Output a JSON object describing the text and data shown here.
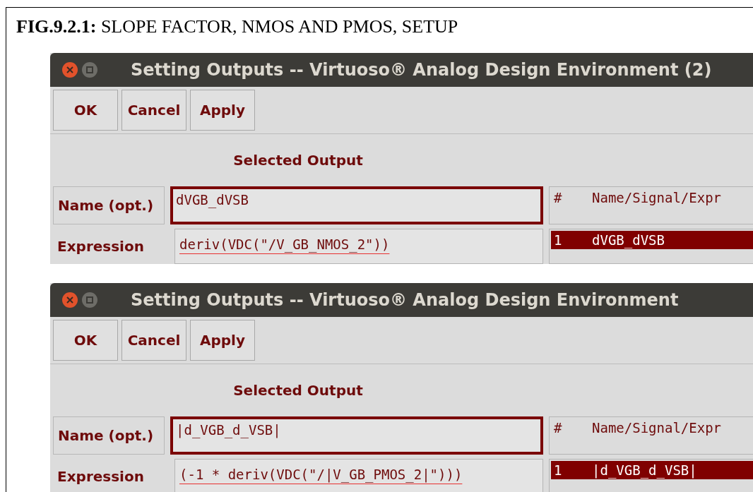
{
  "caption": {
    "label": "FIG.9.2.1:",
    "text": "SLOPE FACTOR, NMOS AND PMOS, SETUP"
  },
  "windows": [
    {
      "title": "Setting Outputs -- Virtuoso® Analog Design Environment (2)",
      "buttons": [
        "OK",
        "Cancel",
        "Apply"
      ],
      "section_title": "Selected Output",
      "name_label": "Name (opt.)",
      "name_value": "dVGB_dVSB",
      "name_focused": true,
      "expression_label": "Expression",
      "expression_value": "deriv(VDC(\"/V_GB_NMOS_2\"))",
      "expression_focused": false,
      "list": {
        "columns": [
          "#",
          "Name/Signal/Expr"
        ],
        "rows": [
          {
            "index": "1",
            "name": "dVGB_dVSB",
            "selected": true
          }
        ]
      }
    },
    {
      "title": "Setting Outputs -- Virtuoso® Analog Design Environment",
      "buttons": [
        "OK",
        "Cancel",
        "Apply"
      ],
      "section_title": "Selected Output",
      "name_label": "Name (opt.)",
      "name_value": "|d_VGB_d_VSB|",
      "name_focused": true,
      "expression_label": "Expression",
      "expression_value": "(-1 * deriv(VDC(\"/|V_GB_PMOS_2|\")))",
      "expression_focused": false,
      "list": {
        "columns": [
          "#",
          "Name/Signal/Expr"
        ],
        "rows": [
          {
            "index": "1",
            "name": "|d_VGB_d_VSB|",
            "selected": true
          }
        ]
      }
    }
  ]
}
